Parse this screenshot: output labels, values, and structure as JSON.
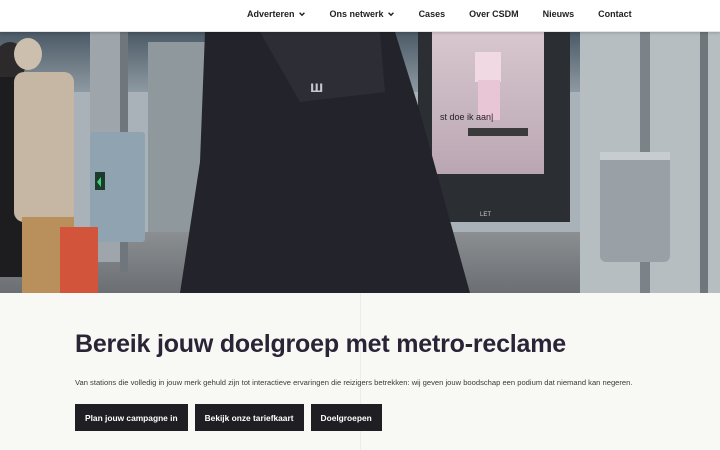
{
  "nav": {
    "items": [
      {
        "label": "Adverteren",
        "has_dropdown": true
      },
      {
        "label": "Ons netwerk",
        "has_dropdown": true
      },
      {
        "label": "Cases",
        "has_dropdown": false
      },
      {
        "label": "Over CSDM",
        "has_dropdown": false
      },
      {
        "label": "Nieuws",
        "has_dropdown": false
      },
      {
        "label": "Contact",
        "has_dropdown": false
      }
    ]
  },
  "hero": {
    "screen_text": "st doe ik aan|",
    "screen_brand": "LET"
  },
  "main": {
    "title": "Bereik jouw doelgroep met metro-reclame",
    "lead": "Van stations die volledig in jouw merk gehuld zijn tot interactieve ervaringen die reizigers betrekken: wij geven jouw boodschap een podium dat niemand kan negeren.",
    "buttons": [
      {
        "label": "Plan jouw campagne in"
      },
      {
        "label": "Bekijk onze tariefkaart"
      },
      {
        "label": "Doelgroepen"
      }
    ]
  },
  "colors": {
    "button_bg": "#1f1f23",
    "headline": "#2b2436",
    "page_bg": "#f8f8f5"
  },
  "icons": [
    "chevron-down-icon"
  ]
}
